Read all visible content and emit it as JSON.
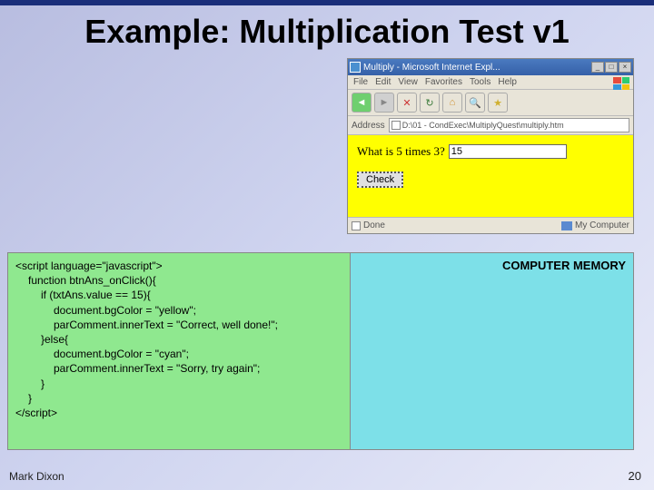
{
  "slide": {
    "title": "Example: Multiplication Test v1",
    "author": "Mark Dixon",
    "page_number": "20"
  },
  "browser": {
    "window_title": "Multiply - Microsoft Internet Expl...",
    "menu": {
      "file": "File",
      "edit": "Edit",
      "view": "View",
      "favorites": "Favorites",
      "tools": "Tools",
      "help": "Help"
    },
    "address_label": "Address",
    "address_value": "D:\\01 - CondExec\\MultiplyQuest\\multiply.htm",
    "page": {
      "question": "What is 5 times 3?",
      "answer_value": "15",
      "check_label": "Check"
    },
    "status": {
      "done": "Done",
      "zone": "My Computer"
    }
  },
  "code": {
    "l1": "<script language=\"javascript\">",
    "l2": "function btnAns_onClick(){",
    "l3": "if (txtAns.value == 15){",
    "l4": "document.bgColor = \"yellow\";",
    "l5": "parComment.innerText = \"Correct, well done!\";",
    "l6": "}else{",
    "l7": "document.bgColor = \"cyan\";",
    "l8": "parComment.innerText = \"Sorry, try again\";",
    "l9": "}",
    "l10": "}",
    "l11": "</script>"
  },
  "memory": {
    "title": "COMPUTER MEMORY"
  }
}
